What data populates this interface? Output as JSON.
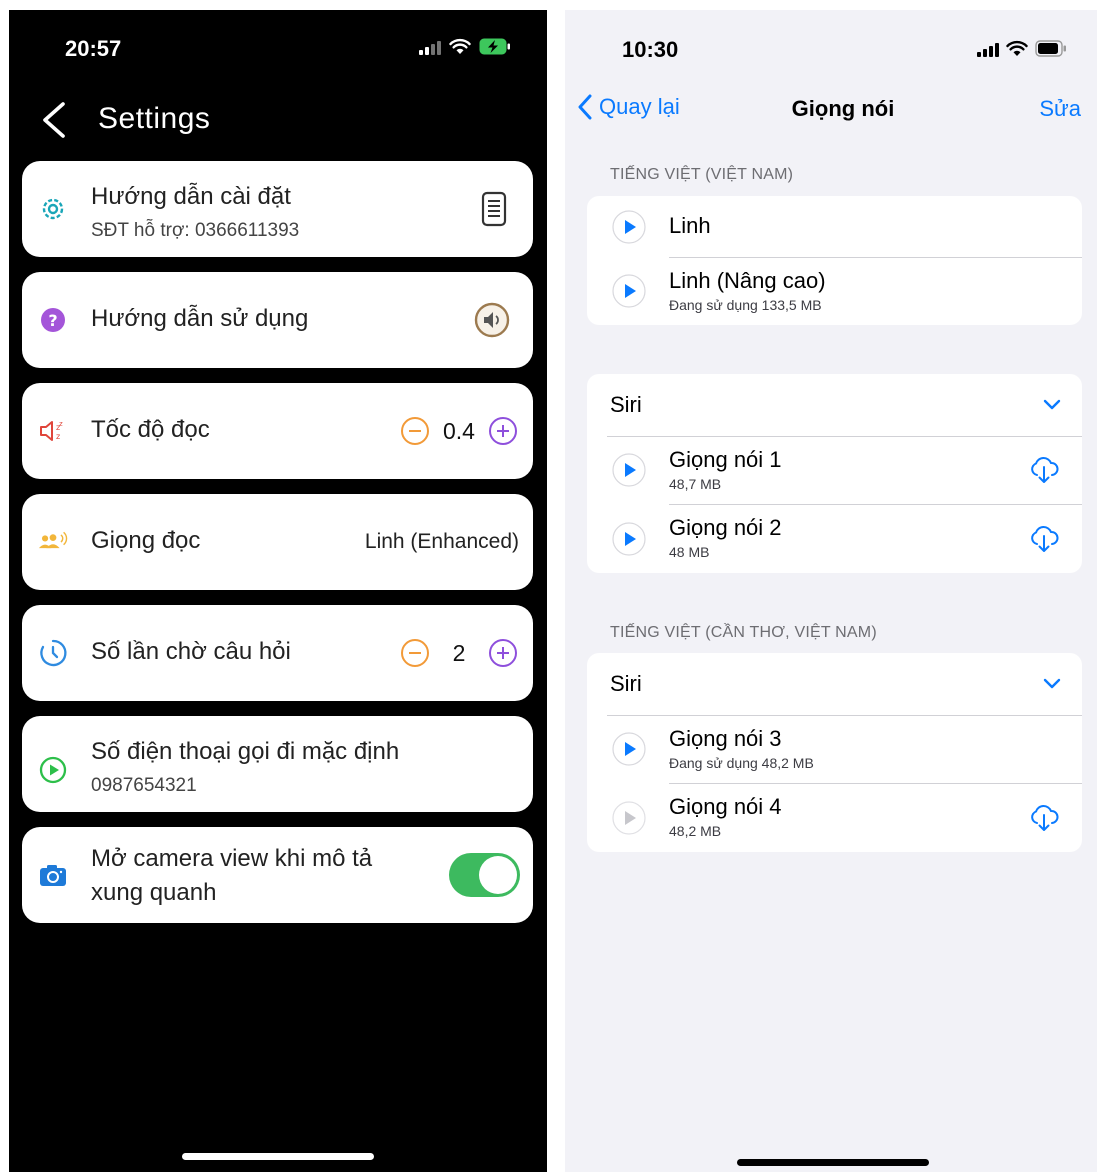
{
  "left": {
    "status": {
      "time": "20:57"
    },
    "title": "Settings",
    "items": [
      {
        "label": "Hướng dẫn cài đặt",
        "sub": "SĐT hỗ trợ: 0366611393"
      },
      {
        "label": "Hướng dẫn sử dụng"
      },
      {
        "label": "Tốc độ đọc",
        "value": "0.4"
      },
      {
        "label": "Giọng đọc",
        "value": "Linh (Enhanced)"
      },
      {
        "label": "Số lần chờ câu hỏi",
        "value": "2"
      },
      {
        "label": "Số điện thoại gọi đi mặc định",
        "sub": "0987654321"
      },
      {
        "label_line1": "Mở camera view khi mô tả",
        "label_line2": "xung quanh",
        "toggle_on": true
      }
    ],
    "colors": {
      "accent_orange": "#f29a38",
      "accent_purple": "#8e4fdc",
      "toggle_green": "#3dba5f"
    }
  },
  "right": {
    "status": {
      "time": "10:30"
    },
    "nav": {
      "back": "Quay lại",
      "title": "Giọng nói",
      "edit": "Sửa"
    },
    "sections": [
      {
        "header": "TIẾNG VIỆT (VIỆT NAM)",
        "rows": [
          {
            "name": "Linh"
          },
          {
            "name": "Linh (Nâng cao)",
            "meta": "Đang sử dụng 133,5 MB"
          }
        ]
      },
      {
        "group_label": "Siri",
        "rows": [
          {
            "name": "Giọng nói 1",
            "meta": "48,7 MB"
          },
          {
            "name": "Giọng nói 2",
            "meta": "48 MB"
          }
        ]
      },
      {
        "header": "TIẾNG VIỆT (CẦN THƠ, VIỆT NAM)",
        "group_label": "Siri",
        "rows": [
          {
            "name": "Giọng nói 3",
            "meta": "Đang sử dụng 48,2 MB"
          },
          {
            "name": "Giọng nói 4",
            "meta": "48,2 MB"
          }
        ]
      }
    ],
    "colors": {
      "tint": "#0a7aff",
      "background": "#f2f2f7"
    }
  }
}
